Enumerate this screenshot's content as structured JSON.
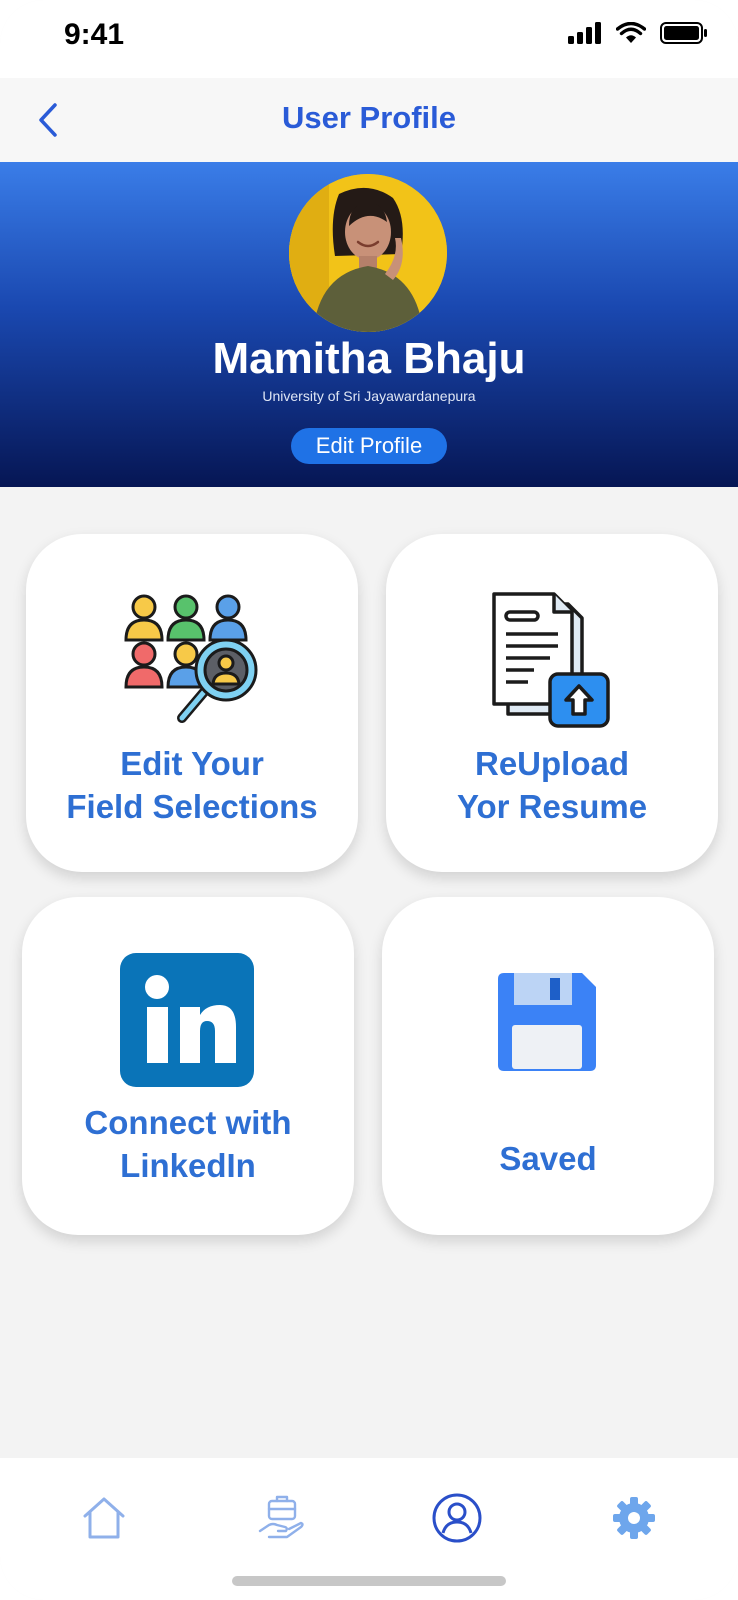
{
  "status": {
    "time": "9:41"
  },
  "header": {
    "title": "User Profile"
  },
  "profile": {
    "name": "Mamitha Bhaju",
    "university": "University of Sri Jayawardanepura",
    "edit_label": "Edit Profile"
  },
  "cards": [
    {
      "line1": "Edit Your",
      "line2": "Field Selections",
      "icon": "people-search-icon"
    },
    {
      "line1": "ReUpload",
      "line2": "Yor Resume",
      "icon": "resume-upload-icon"
    },
    {
      "line1": "Connect with",
      "line2": "LinkedIn",
      "icon": "linkedin-icon"
    },
    {
      "line1": "Saved",
      "line2": "",
      "icon": "floppy-disk-icon"
    }
  ],
  "nav": {
    "items": [
      "home-icon",
      "jobs-hand-icon",
      "profile-icon",
      "settings-icon"
    ],
    "active": "profile-icon"
  },
  "colors": {
    "accent": "#2a5bd7",
    "card_text": "#2e6fd3",
    "banner_top": "#3a7de8",
    "banner_bottom": "#061654",
    "edit_button": "#1f72e6",
    "linkedin": "#0a74b8"
  }
}
